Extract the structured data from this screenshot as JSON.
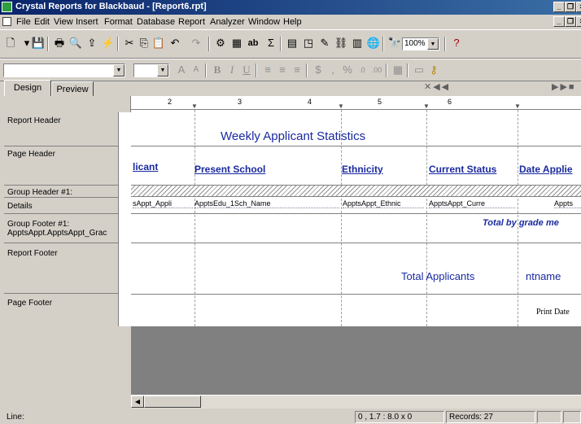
{
  "window": {
    "title": "Crystal Reports for Blackbaud - [Report6.rpt]"
  },
  "menu": [
    "File",
    "Edit",
    "View",
    "Insert",
    "Format",
    "Database",
    "Report",
    "Analyzer",
    "Window",
    "Help"
  ],
  "toolbar": {
    "zoom": "100%"
  },
  "tabs": [
    "Design",
    "Preview"
  ],
  "ruler": [
    "2",
    "3",
    "4",
    "5",
    "6"
  ],
  "sections": [
    {
      "label": "Report Header"
    },
    {
      "label": "Page Header"
    },
    {
      "label": "Group Header #1:"
    },
    {
      "label": "Details"
    },
    {
      "label": "Group Footer #1:\nApptsAppt.ApptsAppt_Grac"
    },
    {
      "label": "Report Footer"
    },
    {
      "label": "Page Footer"
    }
  ],
  "report": {
    "title": "Weekly Applicant Statistics",
    "headers": [
      "licant",
      "Present School",
      "Ethnicity",
      "Current Status",
      "Date Applie"
    ],
    "details": [
      "sAppt_Appli",
      "ApptsEdu_1Sch_Name",
      "ApptsAppt_Ethnic",
      "ApptsAppt_Curre",
      "Appts"
    ],
    "group_footer_text": "Total by grade",
    "group_footer_name": "me",
    "report_footer_text": "Total Applicants",
    "report_footer_name": "ntname",
    "page_footer_text": "Print Date"
  },
  "status": {
    "left": "Line:",
    "position": "0 , 1.7 : 8.0 x 0",
    "records": "Records:  27"
  }
}
